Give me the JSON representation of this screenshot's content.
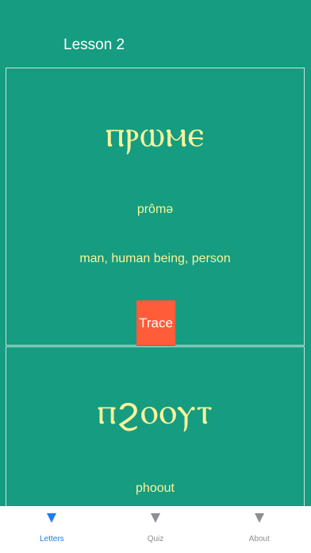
{
  "header": {
    "title": "Lesson 2"
  },
  "cards": [
    {
      "coptic": "ⲡⲣⲱⲙⲉ",
      "transliteration": "prômə",
      "meaning": "man, human being, person",
      "trace_label": "Trace"
    },
    {
      "coptic": "ⲡϩⲟⲟⲩⲧ",
      "transliteration": "phoout"
    }
  ],
  "tabbar": {
    "tabs": [
      {
        "label": "Letters",
        "icon": "triangle-down-icon",
        "active": true
      },
      {
        "label": "Quiz",
        "icon": "triangle-down-icon",
        "active": false
      },
      {
        "label": "About",
        "icon": "triangle-down-icon",
        "active": false
      }
    ]
  },
  "colors": {
    "background": "#169C80",
    "text_accent": "#F7F59B",
    "trace_button": "#FF5C3A",
    "tab_active": "#1E7CF2",
    "tab_inactive": "#8E8E93"
  }
}
